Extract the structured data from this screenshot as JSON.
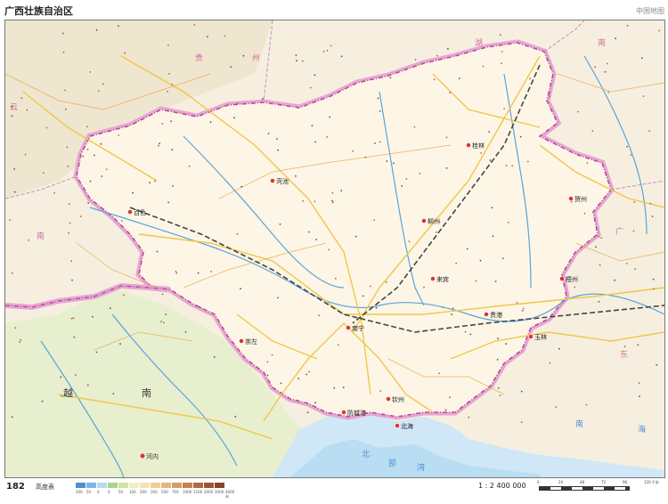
{
  "header": {
    "title": "广西壮族自治区",
    "series": "中国地图"
  },
  "footer": {
    "page_number": "182",
    "elevation_label": "高度表",
    "elevation_ticks": [
      "200",
      "50",
      "0",
      "0",
      "50",
      "100",
      "200",
      "300",
      "500",
      "700",
      "1000",
      "1500",
      "2000",
      "3000",
      "4000 米"
    ],
    "elevation_colors": [
      "#4f8fd0",
      "#7fb6e6",
      "#b6daf4",
      "#a9d48b",
      "#cfe3a2",
      "#efeec1",
      "#f5e3b4",
      "#efcf97",
      "#e3b77e",
      "#d49d67",
      "#c58351",
      "#b06a3f",
      "#9a5535",
      "#85452b"
    ],
    "scale_text": "1 : 2 400 000",
    "scale_ticks": [
      "0",
      "24",
      "48",
      "72",
      "96",
      "120 千米"
    ]
  },
  "map": {
    "colors": {
      "land": "#fbf3e3",
      "neighbor_land": "#f4efe2",
      "sea": "#cfe7f6",
      "border": "#b94a96",
      "border_band": "#e6a6d3",
      "road": "#f0c64a",
      "river": "#5aa4da",
      "railway": "#444444"
    },
    "labels": {
      "neighbor_north": [
        "贵",
        "州"
      ],
      "neighbor_hunan": [
        "湖",
        "南"
      ],
      "neighbor_yunnan": [
        "云",
        "南"
      ],
      "neighbor_guangdong": [
        "广",
        "东"
      ],
      "vietnam": [
        "越",
        "南"
      ],
      "hanoi": "河内",
      "gulf": [
        "北",
        "部",
        "湾"
      ],
      "south_sea": [
        "南",
        "海"
      ],
      "cities": [
        {
          "name": "桂林"
        },
        {
          "name": "柳州"
        },
        {
          "name": "河池"
        },
        {
          "name": "百色"
        },
        {
          "name": "南宁"
        },
        {
          "name": "梧州"
        },
        {
          "name": "贵港"
        },
        {
          "name": "玉林"
        },
        {
          "name": "北海"
        },
        {
          "name": "钦州"
        },
        {
          "name": "防城港"
        },
        {
          "name": "崇左"
        },
        {
          "name": "来宾"
        },
        {
          "name": "贺州"
        }
      ]
    }
  }
}
